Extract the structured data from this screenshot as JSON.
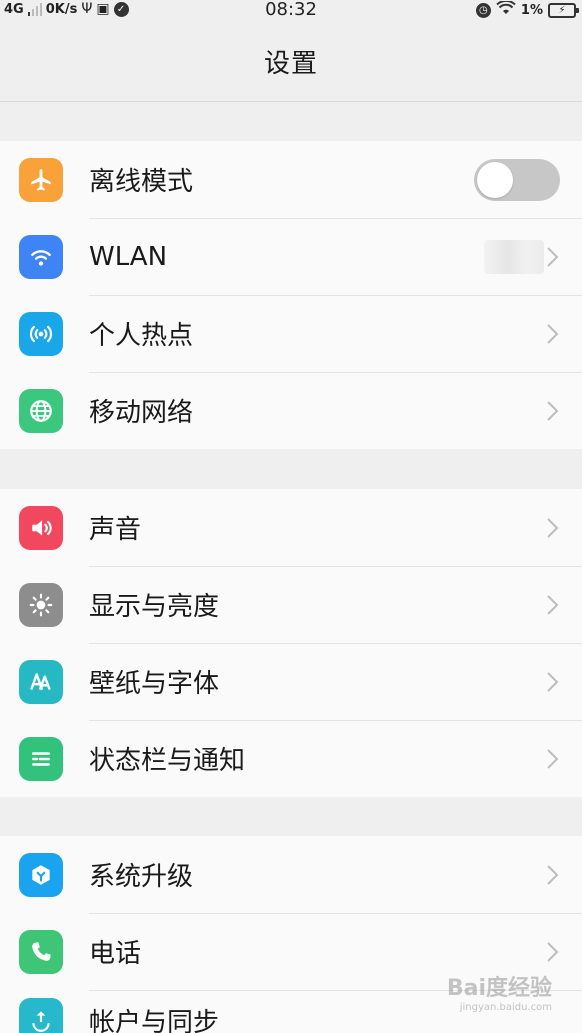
{
  "status_bar": {
    "network": "4G",
    "speed": "0K/s",
    "time": "08:32",
    "battery": "1%"
  },
  "header": {
    "title": "设置"
  },
  "sections": [
    {
      "items": [
        {
          "label": "离线模式",
          "icon": "airplane-icon",
          "color": "#f9a23a",
          "control": "toggle",
          "toggle_on": false
        },
        {
          "label": "WLAN",
          "icon": "wifi-icon",
          "color": "#3f84f5",
          "control": "chevron"
        },
        {
          "label": "个人热点",
          "icon": "hotspot-icon",
          "color": "#1aa7ea",
          "control": "chevron"
        },
        {
          "label": "移动网络",
          "icon": "globe-icon",
          "color": "#3cc77f",
          "control": "chevron"
        }
      ]
    },
    {
      "items": [
        {
          "label": "声音",
          "icon": "speaker-icon",
          "color": "#f2485f",
          "control": "chevron"
        },
        {
          "label": "显示与亮度",
          "icon": "brightness-icon",
          "color": "#8d8d8d",
          "control": "chevron"
        },
        {
          "label": "壁纸与字体",
          "icon": "font-icon",
          "color": "#26b9c3",
          "control": "chevron"
        },
        {
          "label": "状态栏与通知",
          "icon": "notification-icon",
          "color": "#33c27b",
          "control": "chevron"
        }
      ]
    },
    {
      "items": [
        {
          "label": "系统升级",
          "icon": "upgrade-icon",
          "color": "#1aa3ef",
          "control": "chevron"
        },
        {
          "label": "电话",
          "icon": "phone-icon",
          "color": "#3ec676",
          "control": "chevron"
        },
        {
          "label": "帐户与同步",
          "icon": "sync-icon",
          "color": "#27b8cb",
          "control": "chevron"
        }
      ]
    }
  ],
  "watermark": {
    "text": "Bai度经验",
    "sub": "jingyan.baidu.com"
  }
}
